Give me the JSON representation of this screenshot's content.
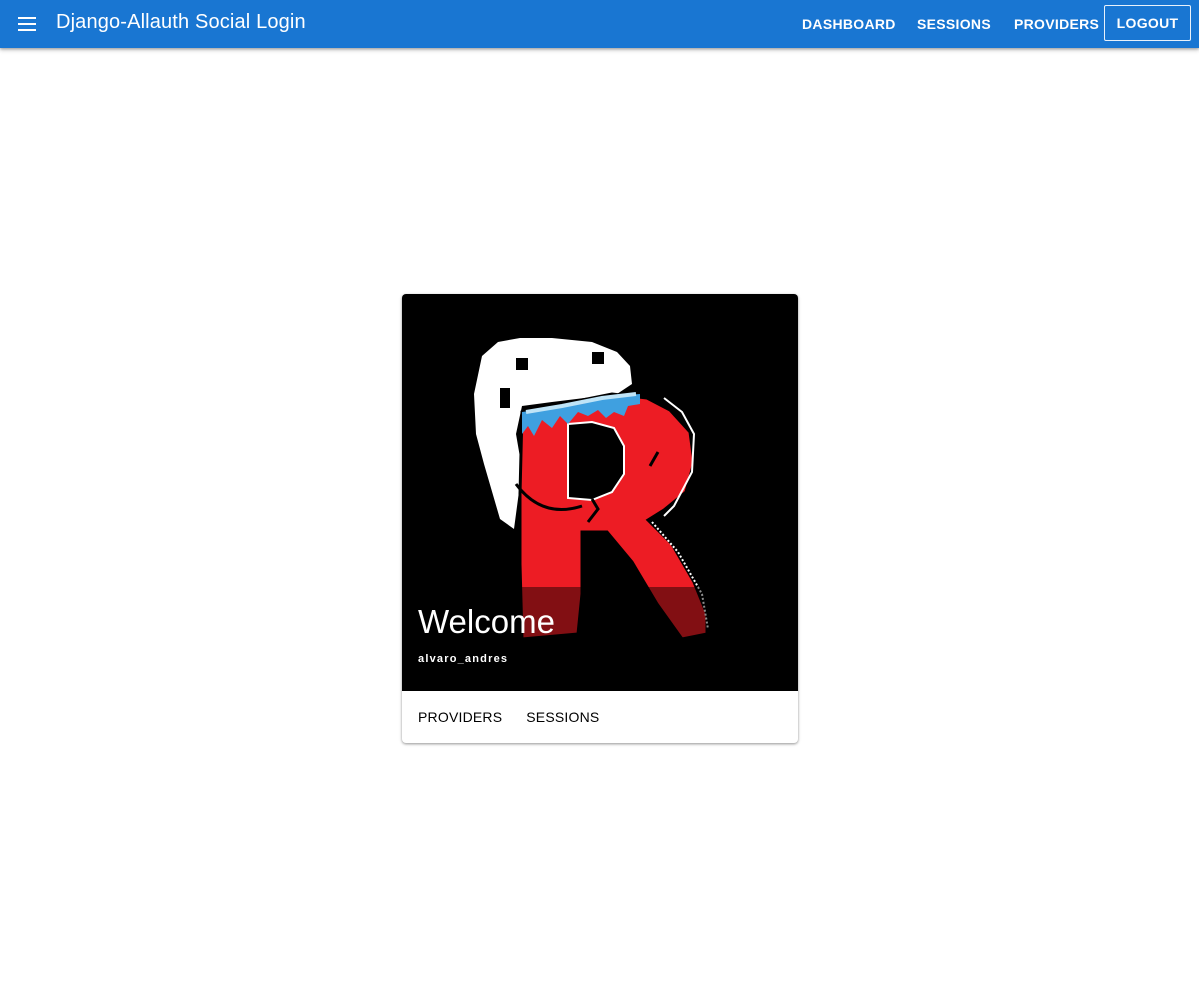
{
  "appbar": {
    "title": "Django-Allauth Social Login",
    "menu_icon": "menu-icon",
    "color": "#1976d2",
    "nav": {
      "dashboard": "DASHBOARD",
      "sessions": "SESSIONS",
      "providers": "PROVIDERS",
      "logout": "LOGOUT"
    }
  },
  "card": {
    "title": "Welcome",
    "subtitle": "alvaro_andres",
    "avatar": "profile-picture-red-letter-r-with-ghost",
    "actions": {
      "providers": "PROVIDERS",
      "sessions": "SESSIONS"
    }
  }
}
